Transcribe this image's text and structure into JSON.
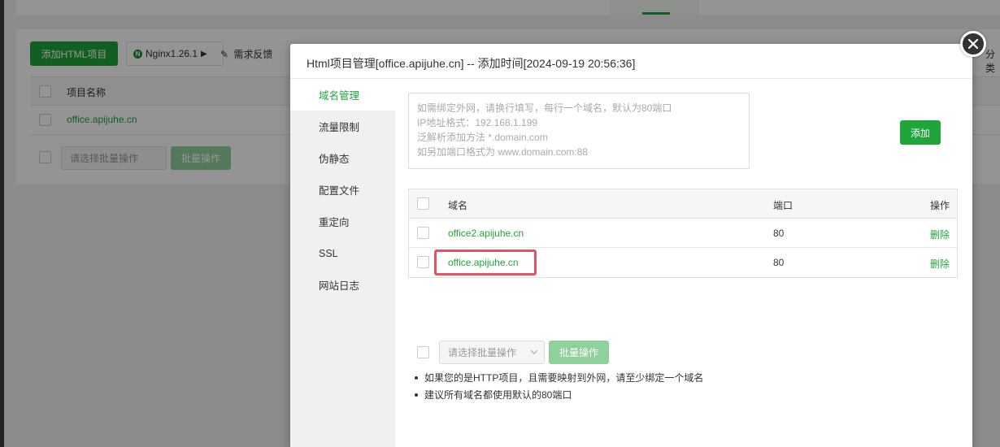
{
  "background": {
    "add_html_button": "添加HTML项目",
    "nginx_button": "Nginx1.26.1",
    "feedback_label": "需求反馈",
    "right_partial_text": "分类",
    "table": {
      "header_name": "项目名称",
      "rows": [
        "office.apijuhe.cn"
      ]
    },
    "batch_select_placeholder": "请选择批量操作",
    "batch_button": "批量操作"
  },
  "dialog": {
    "title": "Html项目管理[office.apijuhe.cn] -- 添加时间[2024-09-19 20:56:36]",
    "sidebar": {
      "items": [
        {
          "label": "域名管理",
          "active": true
        },
        {
          "label": "流量限制",
          "active": false
        },
        {
          "label": "伪静态",
          "active": false
        },
        {
          "label": "配置文件",
          "active": false
        },
        {
          "label": "重定向",
          "active": false
        },
        {
          "label": "SSL",
          "active": false
        },
        {
          "label": "网站日志",
          "active": false
        }
      ]
    },
    "domain_input": {
      "placeholder": "如需绑定外网，请换行填写，每行一个域名，默认为80端口\nIP地址格式：192.168.1.199\n泛解析添加方法 *.domain.com\n如另加端口格式为 www.domain.com:88"
    },
    "add_button": "添加",
    "table": {
      "headers": {
        "domain": "域名",
        "port": "端口",
        "action": "操作"
      },
      "rows": [
        {
          "domain": "office2.apijuhe.cn",
          "port": "80",
          "action": "删除"
        },
        {
          "domain": "office.apijuhe.cn",
          "port": "80",
          "action": "删除"
        }
      ]
    },
    "batch_select_placeholder": "请选择批量操作",
    "batch_button": "批量操作",
    "tips": [
      "如果您的是HTTP项目，且需要映射到外网，请至少绑定一个域名",
      "建议所有域名都使用默认的80端口"
    ]
  },
  "colors": {
    "accent": "#20a53a",
    "accent_disabled": "#8fd19b",
    "highlight": "#e05466"
  }
}
